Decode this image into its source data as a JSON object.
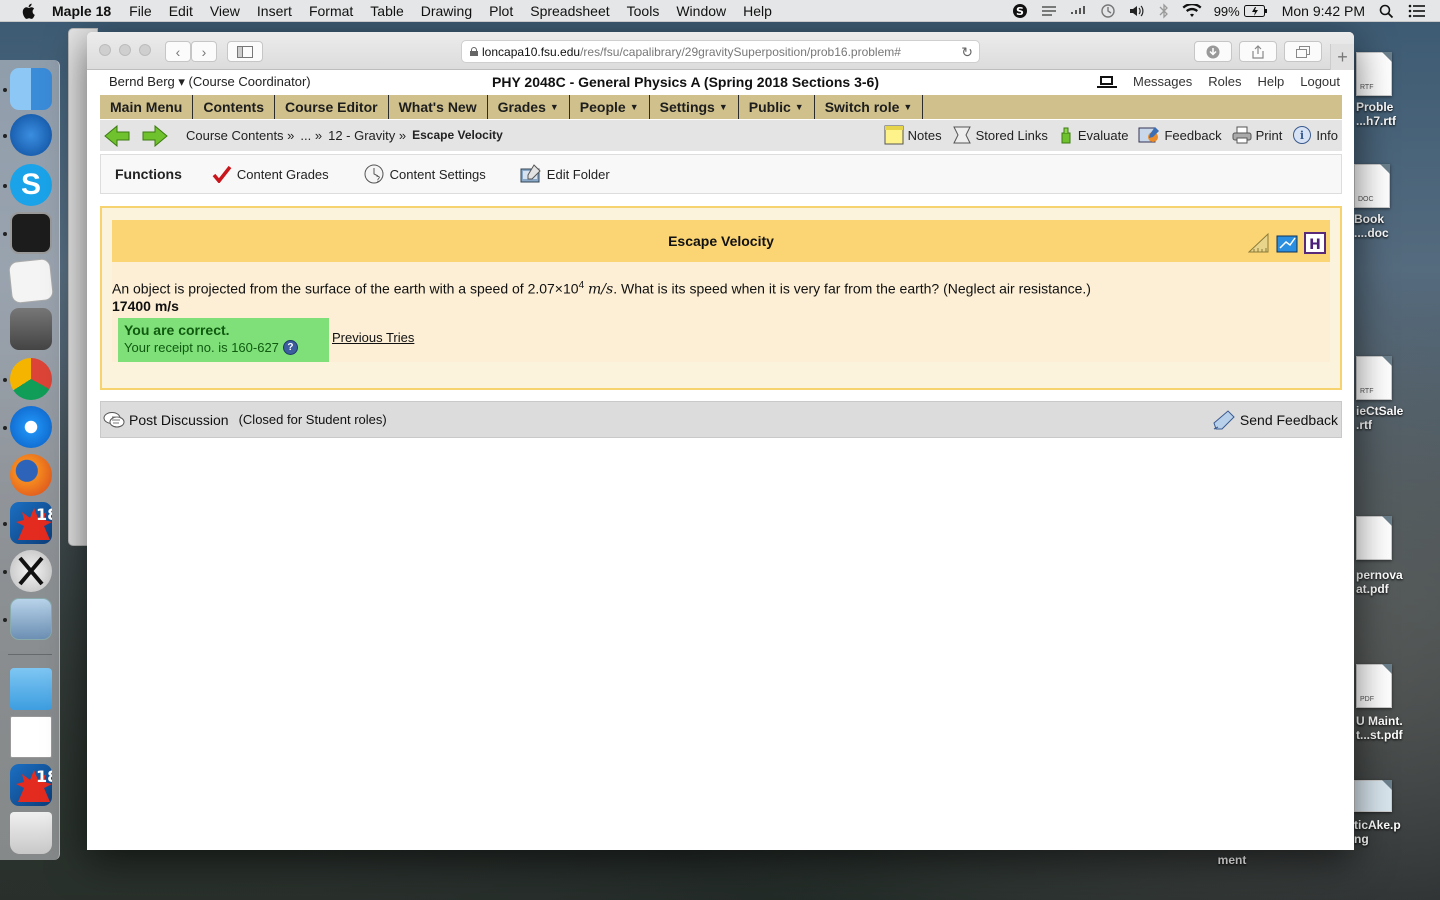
{
  "menubar": {
    "app": "Maple 18",
    "items": [
      "File",
      "Edit",
      "View",
      "Insert",
      "Format",
      "Table",
      "Drawing",
      "Plot",
      "Spreadsheet",
      "Tools",
      "Window",
      "Help"
    ],
    "battery": "99%",
    "clock": "Mon 9:42 PM"
  },
  "browser": {
    "url_host": "loncapa10.fsu.edu",
    "url_path": "/res/fsu/capalibrary/29gravitySuperposition/prob16.problem#"
  },
  "header": {
    "user": "Bernd Berg",
    "role": "(Course Coordinator)",
    "course": "PHY 2048C - General Physics A (Spring 2018 Sections 3-6)",
    "links": [
      "Messages",
      "Roles",
      "Help",
      "Logout"
    ]
  },
  "nav": [
    {
      "label": "Main Menu",
      "menu": false
    },
    {
      "label": "Contents",
      "menu": false
    },
    {
      "label": "Course Editor",
      "menu": false
    },
    {
      "label": "What's New",
      "menu": false
    },
    {
      "label": "Grades",
      "menu": true
    },
    {
      "label": "People",
      "menu": true
    },
    {
      "label": "Settings",
      "menu": true
    },
    {
      "label": "Public",
      "menu": true
    },
    {
      "label": "Switch role",
      "menu": true
    }
  ],
  "breadcrumbs": {
    "items": [
      "Course Contents »",
      "... »",
      "12 - Gravity »"
    ],
    "current": "Escape Velocity"
  },
  "tools": [
    "Notes",
    "Stored Links",
    "Evaluate",
    "Feedback",
    "Print",
    "Info"
  ],
  "functions": {
    "title": "Functions",
    "items": [
      "Content Grades",
      "Content Settings",
      "Edit Folder"
    ]
  },
  "problem": {
    "title": "Escape Velocity",
    "question_pre": "An object is projected from the surface of the earth with a speed of 2.07×10",
    "question_exp": "4",
    "question_unit": "m/s",
    "question_post": ". What is its speed when it is very far from the earth? (Neglect air resistance.)",
    "answer": "17400 m/s",
    "correct_msg": "You are correct.",
    "receipt": "Your receipt no. is 160-627",
    "previous_tries": "Previous Tries"
  },
  "discussion": {
    "post": "Post Discussion",
    "closed": "(Closed for Student roles)",
    "send_feedback": "Send Feedback"
  },
  "desktop_files": [
    {
      "label1": "Proble",
      "label2": "...h7.rtf",
      "tag": "RTF"
    },
    {
      "label1": "Book",
      "label2": "....doc",
      "tag": "DOC"
    },
    {
      "label1": "ieCtSale",
      "label2": ".rtf",
      "tag": "RTF"
    },
    {
      "label1": "pernova",
      "label2": "at.pdf",
      "tag": ""
    },
    {
      "label1": "U Maint.",
      "label2": "t...st.pdf",
      "tag": "PDF"
    },
    {
      "label1": "ticAke.p",
      "label2": "ng",
      "tag": ""
    },
    {
      "label1": "ment",
      "label2": "",
      "tag": ""
    }
  ]
}
